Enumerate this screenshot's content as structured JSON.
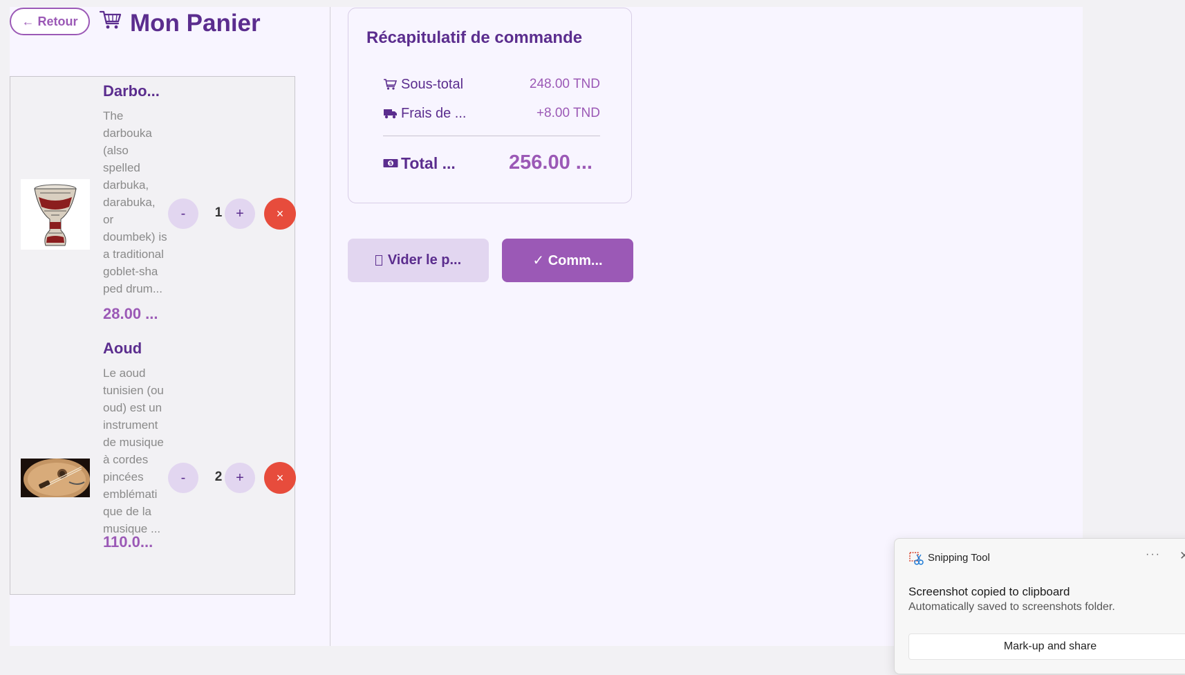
{
  "header": {
    "back_label": "← Retour",
    "title": "Mon Panier"
  },
  "cart": {
    "items": [
      {
        "name": "Darbo...",
        "description": "The darbouka (also spelled darbuka, darabuka, or doumbek) is a traditional goblet-sha ped drum...",
        "price": "28.00 ...",
        "quantity": "1",
        "decrement_label": "-",
        "increment_label": "+",
        "remove_label": "×"
      },
      {
        "name": "Aoud",
        "description": "Le aoud tunisien (ou oud) est un instrument de musique à cordes pincées emblémati que de la musique ...",
        "price": "110.0...",
        "quantity": "2",
        "decrement_label": "-",
        "increment_label": "+",
        "remove_label": "×"
      }
    ]
  },
  "summary": {
    "title": "Récapitulatif de commande",
    "subtotal_label": "Sous-total",
    "subtotal_value": "248.00 TND",
    "shipping_label": "Frais de ...",
    "shipping_value": "+8.00 TND",
    "total_label": "Total ...",
    "total_value": "256.00 ..."
  },
  "actions": {
    "clear_label": "Vider le p...",
    "order_label": "✓ Comm..."
  },
  "toast": {
    "app_name": "Snipping Tool",
    "more_label": "···",
    "close_label": "✕",
    "message": "Screenshot copied to clipboard",
    "submessage": "Automatically saved to screenshots folder.",
    "button_label": "Mark-up and share"
  },
  "colors": {
    "accent": "#9b59b6",
    "heading": "#5b2d8e",
    "danger": "#e74c3c",
    "soft": "#e2d6f0"
  }
}
